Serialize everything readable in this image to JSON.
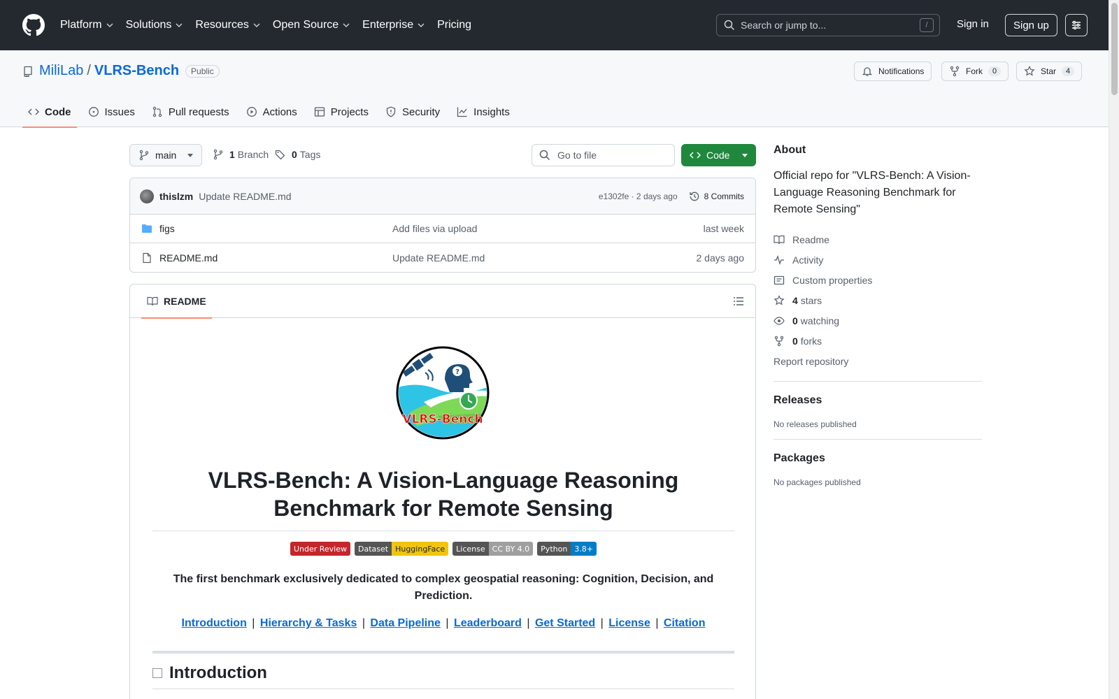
{
  "header": {
    "nav": [
      "Platform",
      "Solutions",
      "Resources",
      "Open Source",
      "Enterprise",
      "Pricing"
    ],
    "search_placeholder": "Search or jump to...",
    "slash_key": "/",
    "sign_in": "Sign in",
    "sign_up": "Sign up"
  },
  "repo": {
    "owner": "MiliLab",
    "separator": "/",
    "name": "VLRS-Bench",
    "visibility": "Public",
    "notifications_label": "Notifications",
    "fork_label": "Fork",
    "fork_count": "0",
    "star_label": "Star",
    "star_count": "4",
    "tabs": [
      "Code",
      "Issues",
      "Pull requests",
      "Actions",
      "Projects",
      "Security",
      "Insights"
    ]
  },
  "toolbar": {
    "branch": "main",
    "branch_count": "1",
    "branch_label": "Branch",
    "tag_count": "0",
    "tag_label": "Tags",
    "goto_placeholder": "Go to file",
    "code_label": "Code"
  },
  "commit": {
    "author": "thislzm",
    "message": "Update README.md",
    "sha_time": "e1302fe · 2 days ago",
    "commits_label": "8 Commits"
  },
  "files": [
    {
      "name": "figs",
      "message": "Add files via upload",
      "date": "last week",
      "type": "folder"
    },
    {
      "name": "README.md",
      "message": "Update README.md",
      "date": "2 days ago",
      "type": "file"
    }
  ],
  "readme": {
    "tab_label": "README",
    "logo_text": "VLRS-Bench",
    "title": "VLRS-Bench: A Vision-Language Reasoning Benchmark for Remote Sensing",
    "badges": [
      {
        "left": "Under Review",
        "right": "",
        "left_color": "#c3272b",
        "right_color": ""
      },
      {
        "left": "Dataset",
        "right": "HuggingFace",
        "left_color": "#555555",
        "right_color": "#f1c40f"
      },
      {
        "left": "License",
        "right": "CC BY 4.0",
        "left_color": "#555555",
        "right_color": "#9f9f9f"
      },
      {
        "left": "Python",
        "right": "3.8+",
        "left_color": "#555555",
        "right_color": "#007ec6"
      }
    ],
    "tagline": "The first benchmark exclusively dedicated to complex geospatial reasoning: Cognition, Decision, and Prediction.",
    "links": [
      "Introduction",
      "Hierarchy & Tasks",
      "Data Pipeline",
      "Leaderboard",
      "Get Started",
      "License",
      "Citation"
    ],
    "link_separator": "|",
    "intro_heading": "Introduction"
  },
  "sidebar": {
    "about_title": "About",
    "description": "Official repo for \"VLRS-Bench: A Vision-Language Reasoning Benchmark for Remote Sensing\"",
    "readme": "Readme",
    "activity": "Activity",
    "custom_properties": "Custom properties",
    "stars_count": "4",
    "stars_label": "stars",
    "watching_count": "0",
    "watching_label": "watching",
    "forks_count": "0",
    "forks_label": "forks",
    "report": "Report repository",
    "releases_title": "Releases",
    "releases_text": "No releases published",
    "packages_title": "Packages",
    "packages_text": "No packages published"
  }
}
